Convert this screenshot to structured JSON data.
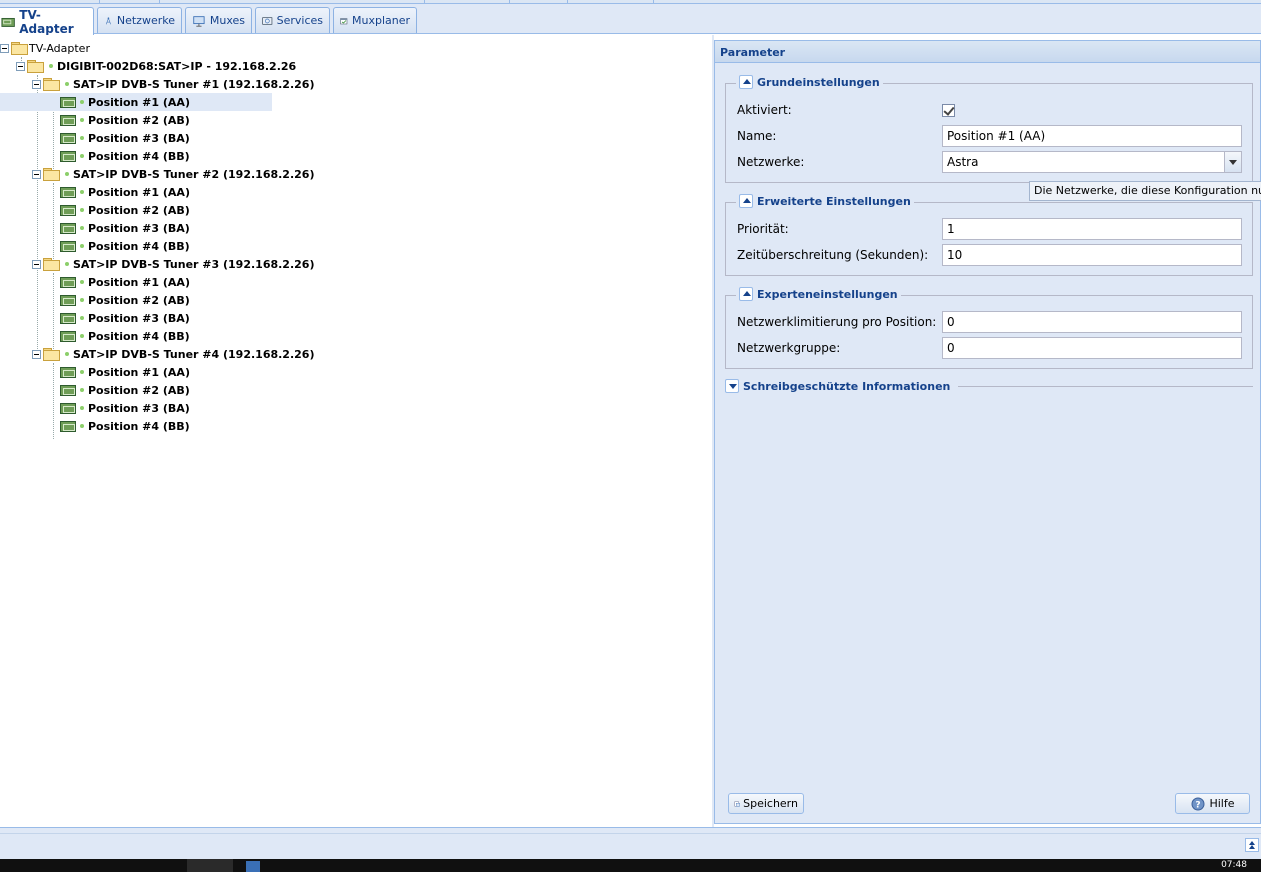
{
  "tabs": [
    {
      "label": "TV-Adapter",
      "icon": "tv-card-icon",
      "active": true
    },
    {
      "label": "Netzwerke",
      "icon": "antenna-icon",
      "active": false
    },
    {
      "label": "Muxes",
      "icon": "monitor-icon",
      "active": false
    },
    {
      "label": "Services",
      "icon": "tv-icon",
      "active": false
    },
    {
      "label": "Muxplaner",
      "icon": "calendar-check-icon",
      "active": false
    }
  ],
  "tree": {
    "root": "TV-Adapter",
    "device": "DIGIBIT-002D68:SAT>IP - 192.168.2.26",
    "tuners": [
      {
        "label": "SAT>IP DVB-S Tuner #1 (192.168.2.26)",
        "positions": [
          "Position #1 (AA)",
          "Position #2 (AB)",
          "Position #3 (BA)",
          "Position #4 (BB)"
        ]
      },
      {
        "label": "SAT>IP DVB-S Tuner #2 (192.168.2.26)",
        "positions": [
          "Position #1 (AA)",
          "Position #2 (AB)",
          "Position #3 (BA)",
          "Position #4 (BB)"
        ]
      },
      {
        "label": "SAT>IP DVB-S Tuner #3 (192.168.2.26)",
        "positions": [
          "Position #1 (AA)",
          "Position #2 (AB)",
          "Position #3 (BA)",
          "Position #4 (BB)"
        ]
      },
      {
        "label": "SAT>IP DVB-S Tuner #4 (192.168.2.26)",
        "positions": [
          "Position #1 (AA)",
          "Position #2 (AB)",
          "Position #3 (BA)",
          "Position #4 (BB)"
        ]
      }
    ]
  },
  "panel": {
    "title": "Parameter",
    "basic": {
      "legend": "Grundeinstellungen",
      "enabled_label": "Aktiviert:",
      "enabled": true,
      "name_label": "Name:",
      "name_value": "Position #1 (AA)",
      "networks_label": "Netzwerke:",
      "networks_value": "Astra"
    },
    "advanced": {
      "legend": "Erweiterte Einstellungen",
      "priority_label": "Priorität:",
      "priority_value": "1",
      "timeout_label": "Zeitüberschreitung (Sekunden):",
      "timeout_value": "10"
    },
    "expert": {
      "legend": "Experteneinstellungen",
      "netlimit_label": "Netzwerklimitierung pro Position:",
      "netlimit_value": "0",
      "netgroup_label": "Netzwerkgruppe:",
      "netgroup_value": "0"
    },
    "readonly": {
      "legend": "Schreibgeschützte Informationen"
    },
    "save_label": "Speichern",
    "help_label": "Hilfe"
  },
  "tooltip": "Die Netzwerke, die diese Konfiguration nutzen.",
  "clock": "07:48",
  "colors": {
    "accent": "#15428b",
    "panel_bg": "#dfe8f6",
    "border": "#99bbe8",
    "selected": "#dfe8f6"
  }
}
